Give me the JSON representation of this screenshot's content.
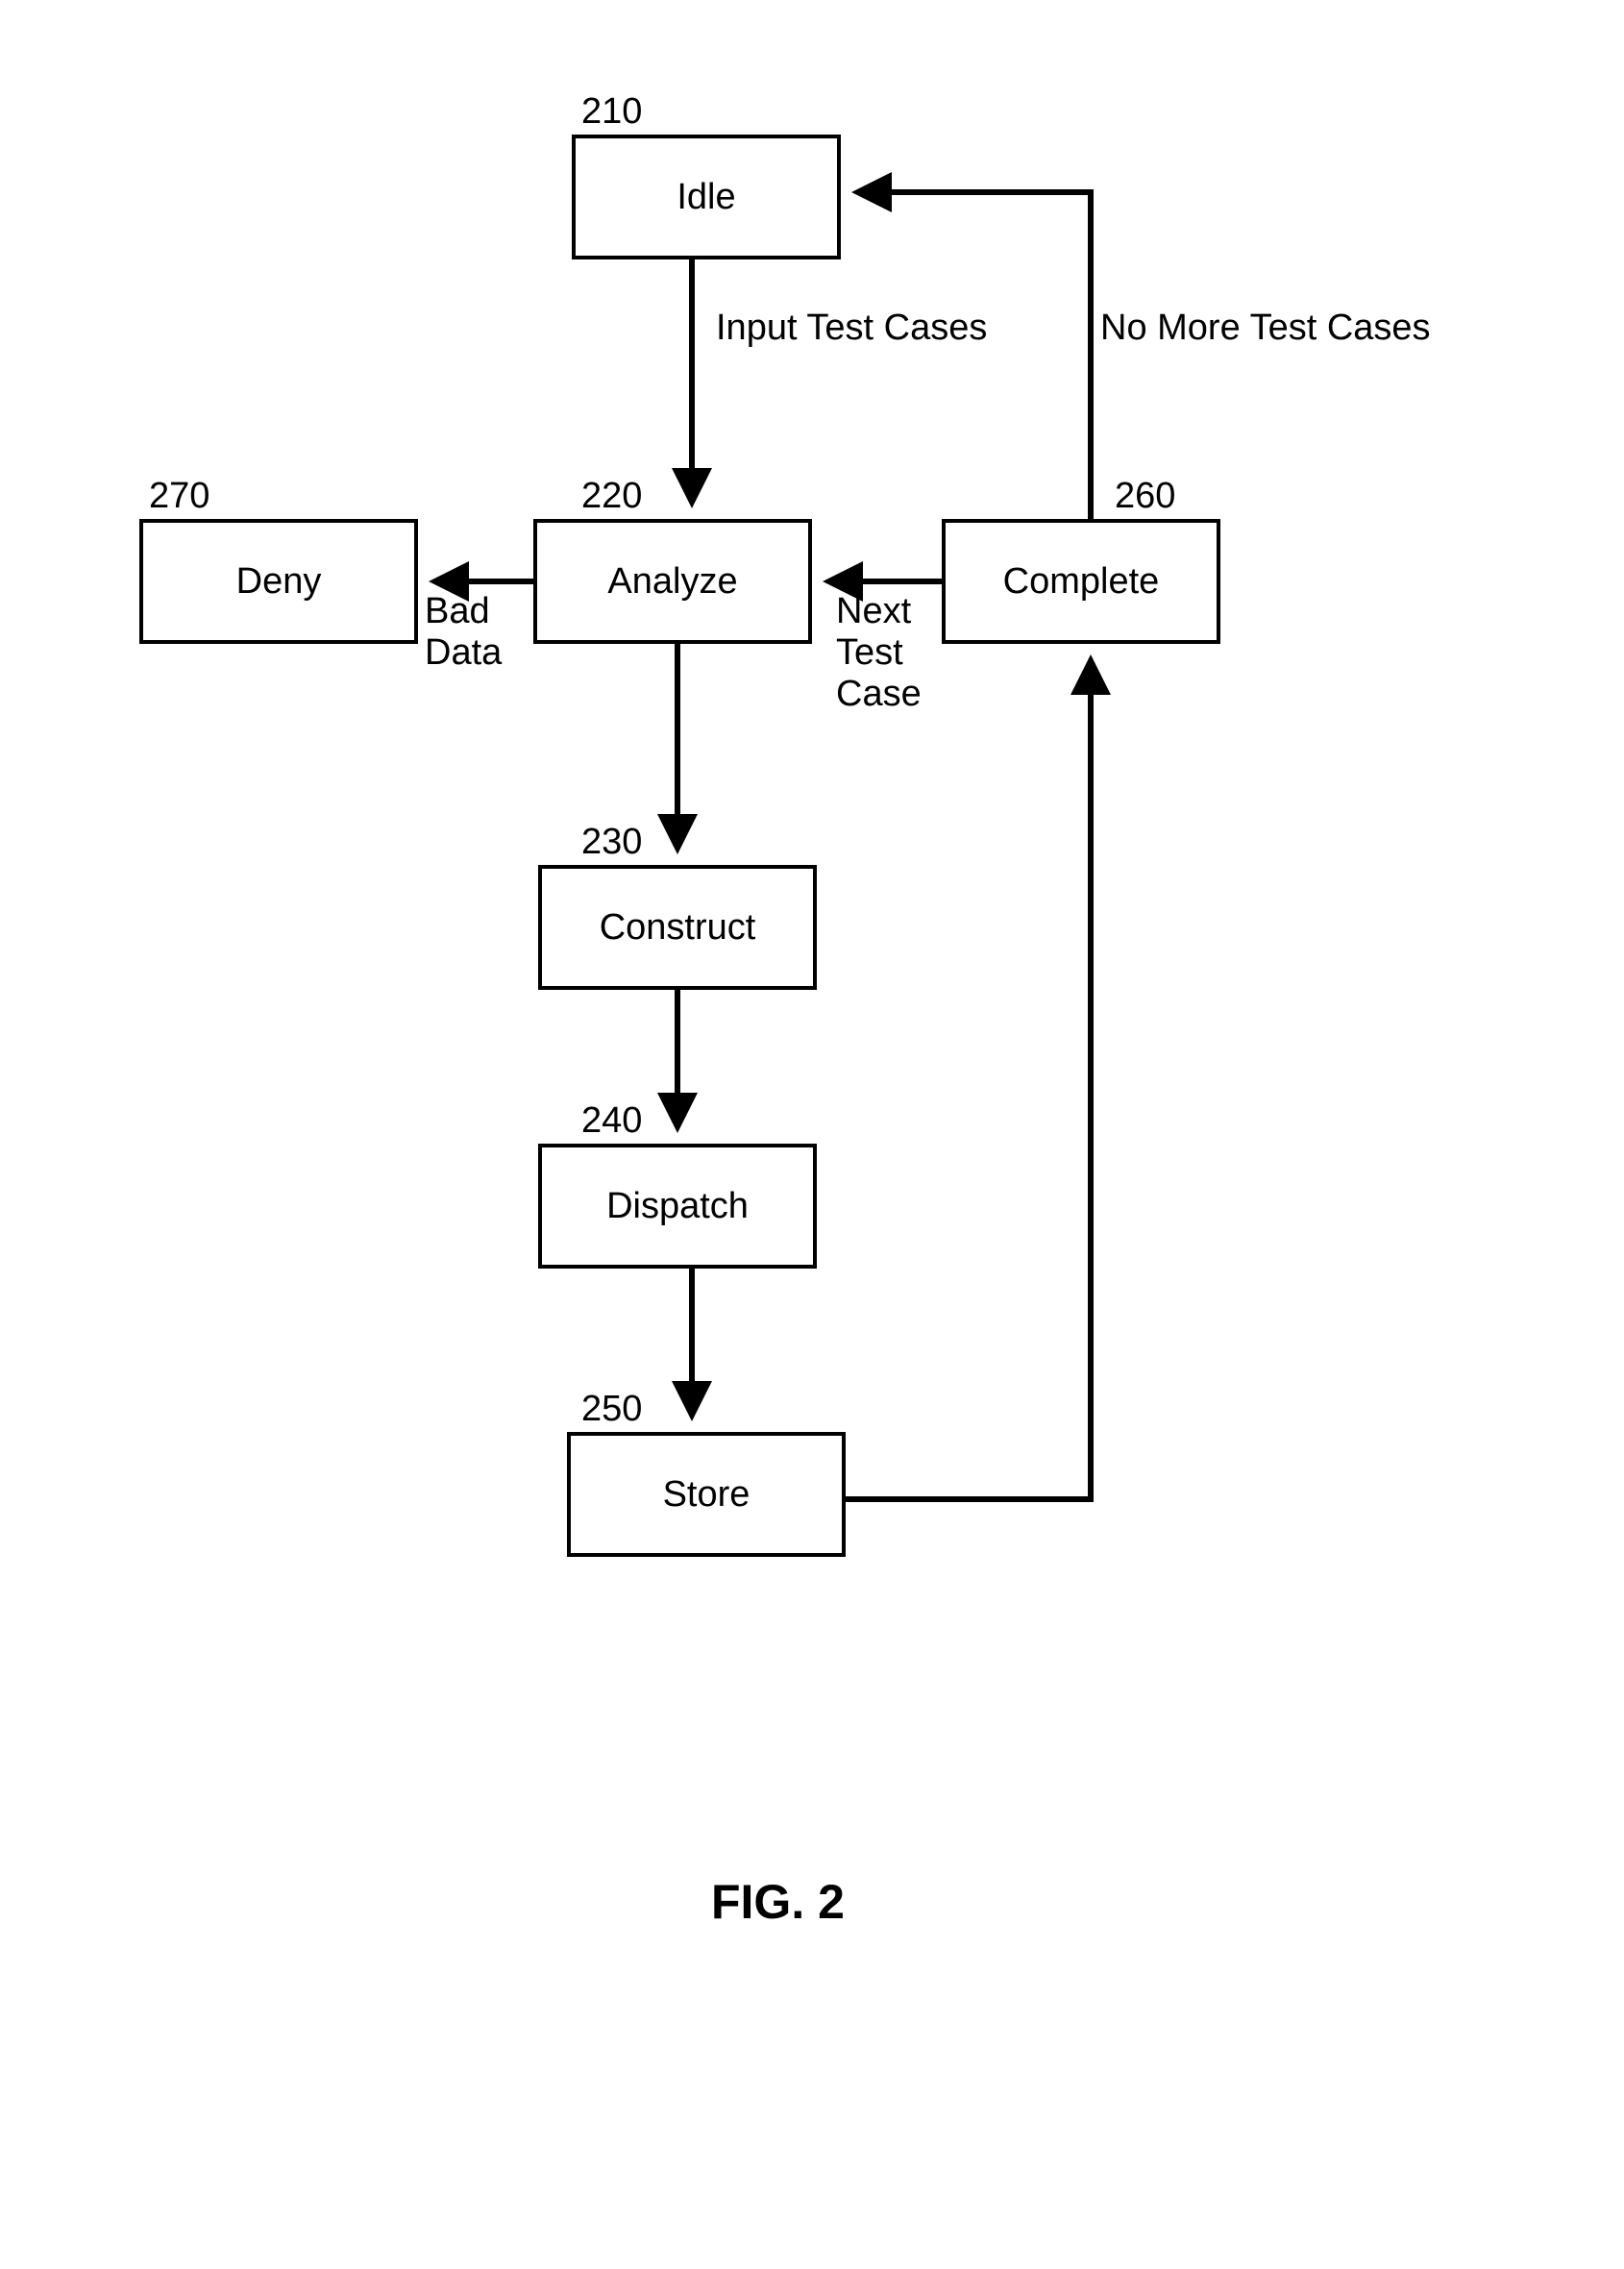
{
  "figure_label": "FIG. 2",
  "nodes": {
    "idle": {
      "ref": "210",
      "label": "Idle"
    },
    "analyze": {
      "ref": "220",
      "label": "Analyze"
    },
    "construct": {
      "ref": "230",
      "label": "Construct"
    },
    "dispatch": {
      "ref": "240",
      "label": "Dispatch"
    },
    "store": {
      "ref": "250",
      "label": "Store"
    },
    "complete": {
      "ref": "260",
      "label": "Complete"
    },
    "deny": {
      "ref": "270",
      "label": "Deny"
    }
  },
  "edges": {
    "idle_to_analyze": "Input Test Cases",
    "analyze_to_deny": "Bad\nData",
    "complete_to_analyze": "Next\nTest\nCase",
    "complete_to_idle": "No More Test Cases"
  }
}
